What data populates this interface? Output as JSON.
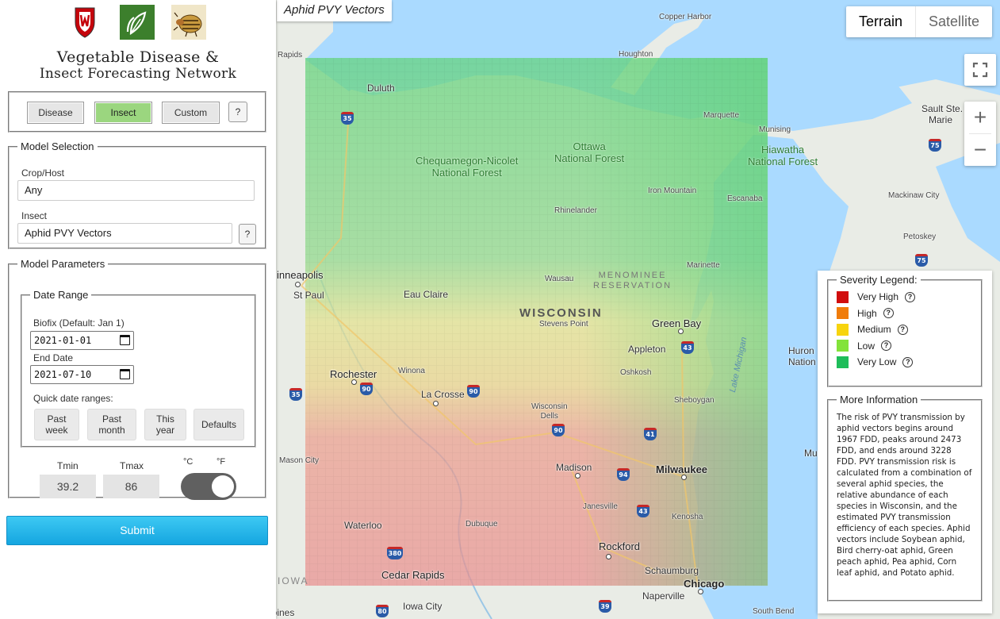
{
  "map": {
    "title": "Aphid PVY Vectors",
    "map_types": [
      "Terrain",
      "Satellite"
    ],
    "zoom_in": "+",
    "zoom_out": "−",
    "labels": {
      "copper_harbor": "Copper Harbor",
      "houghton": "Houghton",
      "duluth": "Duluth",
      "marquette": "Marquette",
      "munising": "Munising",
      "sault": "Sault Ste.",
      "marie": "Marie",
      "ottawa": "Ottawa\nNational Forest",
      "chequamegon": "Chequamegon-Nicolet\nNational Forest",
      "hiawatha": "Hiawatha\nNational Forest",
      "iron_mountain": "Iron Mountain",
      "escanaba": "Escanaba",
      "rhinelander": "Rhinelander",
      "mackinaw": "Mackinaw City",
      "petoskey": "Petoskey",
      "marinette": "Marinette",
      "wausau": "Wausau",
      "menominee": "MENOMINEE\nRESERVATION",
      "minneapolis": "inneapolis",
      "st_paul": "St Paul",
      "eau_claire": "Eau Claire",
      "wisconsin": "WISCONSIN",
      "stevens_point": "Stevens Point",
      "green_bay": "Green Bay",
      "appleton": "Appleton",
      "huron": "Huron\nNation",
      "oshkosh": "Oshkosh",
      "rochester": "Rochester",
      "winona": "Winona",
      "la_crosse": "La Crosse",
      "wisconsin_dells": "Wisconsin\nDells",
      "sheboygan": "Sheboygan",
      "lake_michigan": "Lake Michigan",
      "mason_city": "Mason City",
      "madison": "Madison",
      "milwaukee": "Milwaukee",
      "muskegon": "Muskeg",
      "janesville": "Janesville",
      "kenosha": "Kenosha",
      "waterloo": "Waterloo",
      "dubuque": "Dubuque",
      "rockford": "Rockford",
      "cedar_rapids": "Cedar Rapids",
      "schaumburg": "Schaumburg",
      "chicago": "Chicago",
      "naperville": "Naperville",
      "iowa": "IOWA",
      "iowa_city": "Iowa City",
      "des_moines": "Des Moines",
      "south_bend": "South Bend",
      "rapids": "Rapids"
    },
    "shields": {
      "i35a": "35",
      "i35b": "35",
      "i90a": "90",
      "i90b": "90",
      "i90c": "90",
      "i94": "94",
      "i43a": "43",
      "i43b": "43",
      "i41": "41",
      "i75a": "75",
      "i75b": "75",
      "i380": "380",
      "i80": "80",
      "i39": "39"
    }
  },
  "legend": {
    "severity_title": "Severity Legend:",
    "levels": [
      {
        "label": "Very High",
        "color": "#d10d0d"
      },
      {
        "label": "High",
        "color": "#f07c0a"
      },
      {
        "label": "Medium",
        "color": "#f7d40e"
      },
      {
        "label": "Low",
        "color": "#83e33a"
      },
      {
        "label": "Very Low",
        "color": "#1fbd5a"
      }
    ],
    "help_glyph": "?",
    "more_info_title": "More Information",
    "more_info_text": "The risk of PVY transmission by aphid vectors begins around 1967 FDD, peaks around 2473 FDD, and ends around 3228 FDD. PVY transmission risk is calculated from a combination of several aphid species, the relative abundance of each species in Wisconsin, and the estimated PVY transmission efficiency of each species. Aphid vectors include Soybean aphid, Bird cherry-oat aphid, Green peach aphid, Pea aphid, Corn leaf aphid, and Potato aphid."
  },
  "sidebar": {
    "title_line1": "Vegetable Disease &",
    "title_line2": "Insect Forecasting Network",
    "modes": {
      "disease": "Disease",
      "insect": "Insect",
      "custom": "Custom",
      "help": "?"
    },
    "model_selection": {
      "legend": "Model Selection",
      "crop_label": "Crop/Host",
      "crop_value": "Any",
      "insect_label": "Insect",
      "insect_value": "Aphid PVY Vectors",
      "help": "?"
    },
    "model_parameters": {
      "legend": "Model Parameters",
      "date_range_legend": "Date Range",
      "biofix_label": "Biofix (Default: Jan 1)",
      "biofix_value": "2021-01-01",
      "end_label": "End Date",
      "end_value": "2021-07-10",
      "quick_label": "Quick date ranges:",
      "quick": [
        "Past\nweek",
        "Past\nmonth",
        "This\nyear",
        "Defaults"
      ],
      "tmin_label": "Tmin",
      "tmin_value": "39.2",
      "tmax_label": "Tmax",
      "tmax_value": "86",
      "unit_c": "°C",
      "unit_f": "°F",
      "unit_selected": "°F"
    },
    "submit": "Submit"
  }
}
